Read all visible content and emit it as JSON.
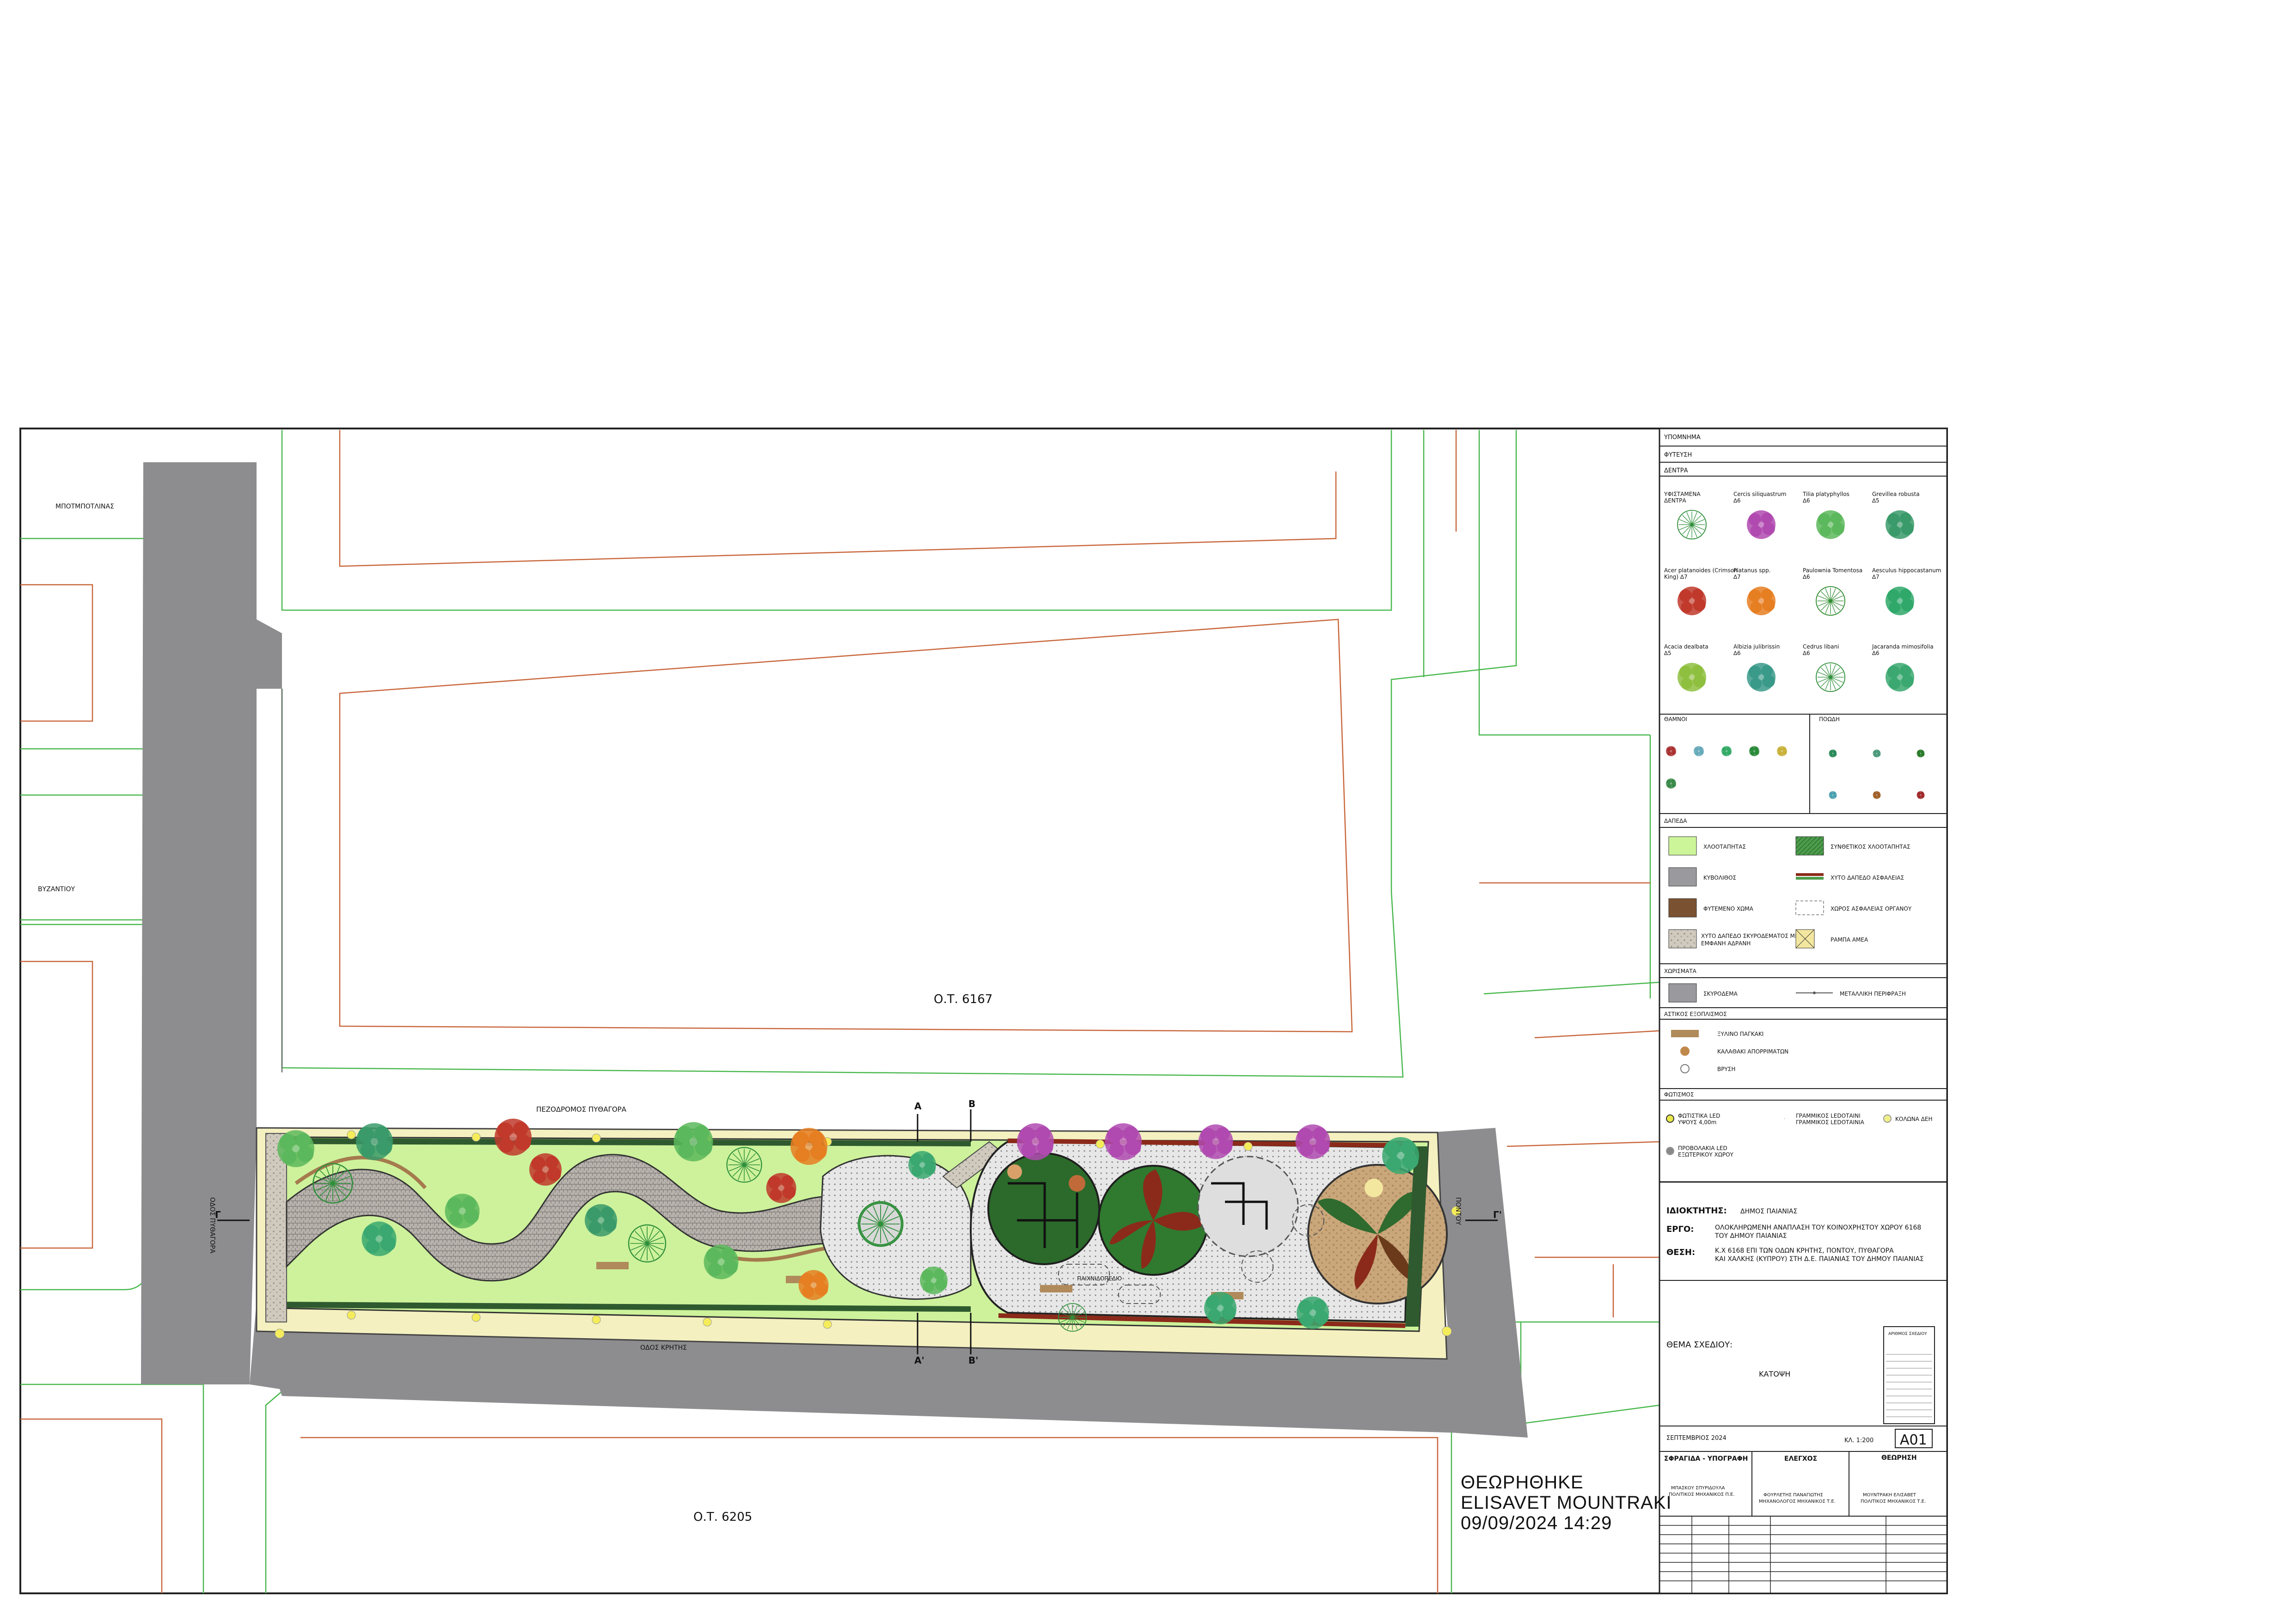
{
  "site_plan": {
    "blocks": {
      "block_north": "Ο.Τ. 6167",
      "block_south": "Ο.Τ. 6205"
    },
    "streets": {
      "street_top_left": "ΜΠΟΤΜΠΟΤΛΙΝΑΣ",
      "street_mid_left": "ΒΥΖΑΝΤΙΟΥ",
      "street_west_vertical": "ΟΔΟΣ ΠΥΘΑΓΟΡΑ",
      "pedestrian_street": "ΠΕΖΟΔΡΟΜΟΣ ΠΥΘΑΓΟΡΑ",
      "street_south": "ΟΔΟΣ ΚΡΗΤΗΣ",
      "street_east": "ΠΟΝΤΟΥ"
    },
    "section_labels": [
      "Γ",
      "Γ'",
      "Α",
      "Α'",
      "Β",
      "Β'"
    ],
    "playground_label": "ΠΑΙΧΝΙΔΟΠΕΔΙΟ"
  },
  "legend": {
    "title": "ΥΠΟΜΝΗΜΑ",
    "planting_title": "ΦΥΤΕΥΣΗ",
    "trees_title": "ΔΕΝΤΡΑ",
    "trees": [
      {
        "label": "ΥΦΙΣΤΑΜΕΝΑ ΔΕΝΤΡΑ",
        "color": "#2f8f3a",
        "style": "line"
      },
      {
        "label": "Cercis siliquastrum ∆6",
        "color": "#b04ab0",
        "style": "blob"
      },
      {
        "label": "Tilia platyphyllos ∆6",
        "color": "#5cb85c",
        "style": "blob"
      },
      {
        "label": "Grevillea robusta ∆5",
        "color": "#3a9a6a",
        "style": "blob"
      },
      {
        "label": "Acer platanoides (Crimson King) ∆7",
        "color": "#c0392b",
        "style": "blob"
      },
      {
        "label": "Platanus spp. ∆7",
        "color": "#e67e22",
        "style": "blob"
      },
      {
        "label": "Paulownia Tomentosa ∆6",
        "color": "#2e8b2e",
        "style": "line"
      },
      {
        "label": "Aesculus hippocastanum ∆7",
        "color": "#2fa86a",
        "style": "blob"
      },
      {
        "label": "Acacia dealbata ∆5",
        "color": "#8fbf3f",
        "style": "blob"
      },
      {
        "label": "Albizia julibrissin ∆6",
        "color": "#3a9a8a",
        "style": "blob"
      },
      {
        "label": "Cedrus libani ∆6",
        "color": "#2f8f3a",
        "style": "line"
      },
      {
        "label": "Jacaranda mimosifolia ∆6",
        "color": "#3aa870",
        "style": "blob"
      }
    ],
    "shrubs_title": "ΘΑΜΝΟΙ",
    "shrub_colors": [
      "#a33",
      "#6ab",
      "#3a6",
      "#2a8a3a",
      "#c9b23a",
      "#3a8a4a"
    ],
    "groundcover_title": "ΠΟΩΔΗ",
    "groundcover_colors": [
      "#2a8a5a",
      "#4a9a7a",
      "#2a7a2a",
      "#4aa0b0",
      "#a0602a",
      "#a02a2a"
    ],
    "floors_title": "ΔΑΠΕΔΑ",
    "floors": [
      {
        "label": "ΧΛΟΟΤΑΠΗΤΑΣ",
        "color": "#ccf59a"
      },
      {
        "label": "ΣΥΝΘΕΤΙΚΟΣ ΧΛΟΟΤΑΠΗΤΑΣ",
        "color": "#4c9c4c"
      },
      {
        "label": "ΚΥΒΟΛΙΘΟΣ",
        "color": "#9a9a9e"
      },
      {
        "label": "ΧΥΤΟ ΔΑΠΕΔΟ ΑΣΦΑΛΕΙΑΣ",
        "color": "#8b2a1a"
      },
      {
        "label": "ΦΥΤΕΜΕΝΟ ΧΩΜΑ",
        "color": "#7a5232"
      },
      {
        "label": "ΧΩΡΟΣ ΑΣΦΑΛΕΙΑΣ ΟΡΓΑΝΟΥ",
        "color": "#ffffff"
      },
      {
        "label": "ΧΥΤΟ ΔΑΠΕΔΟ ΣΚΥΡΟΔΕΜΑΤΟΣ ΜΕ ΕΜΦΑΝΗ ΑΔΡΑΝΗ",
        "color": "#d8d2c4"
      },
      {
        "label": "ΡΑΜΠΑ ΑΜΕΑ",
        "color": "#f3e7a0"
      }
    ],
    "walls_title": "ΧΩΡΙΣΜΑΤΑ",
    "walls": [
      {
        "label": "ΣΚΥΡΟΔΕΜΑ",
        "color": "#9a9a9e"
      },
      {
        "label": "ΜΕΤΑΛΛΙΚΗ ΠΕΡΙΦΡΑΞΗ",
        "color": "#555555"
      }
    ],
    "furniture_title": "ΑΣΤΙΚΟΣ ΕΞΟΠΛΙΣΜΟΣ",
    "furniture": [
      {
        "label": "ΞΥΛΙΝΟ ΠΑΓΚΑΚΙ",
        "color": "#b08a5a"
      },
      {
        "label": "ΚΑΛΑΘΑΚΙ ΑΠΟΡΡΙΜΑΤΩΝ",
        "color": "#c0884a"
      },
      {
        "label": "ΒΡΥΣΗ",
        "color": "#777777"
      }
    ],
    "lighting_title": "ΦΩΤΙΣΜΟΣ",
    "lighting": [
      {
        "label": "ΦΩΤΙΣΤΙΚΑ LED ΥΨΟΥΣ 4,00m",
        "color": "#e8e84a"
      },
      {
        "label": "ΓΡΑΜΜΙΚΟΣ LEDΟΤΑΙΝΙΑ",
        "color": "#333333"
      },
      {
        "label": "ΚΟΛΩΝΑ ΔΕΗ",
        "color": "#f0f08a"
      },
      {
        "label": "ΠΡΟΒΟΛΑΚΙΑ LED ΕΞΩΤΕΡΙΚΟΥ ΧΩΡΟΥ",
        "color": "#888888"
      }
    ]
  },
  "title_block": {
    "owner_label": "ΙΔΙΟΚΤΗΤΗΣ:",
    "owner_value": "ΔΗΜΟΣ ΠΑΙΑΝΙΑΣ",
    "project_label": "ΕΡΓΟ:",
    "project_value_1": "ΟΛΟΚΛΗΡΩΜΕΝΗ ΑΝΑΠΛΑΣΗ ΤΟΥ ΚΟΙΝΟΧΡΗΣΤΟΥ ΧΩΡΟΥ 6168",
    "project_value_2": "ΤΟΥ ΔΗΜΟΥ ΠΑΙΑΝΙΑΣ",
    "location_label": "ΘΕΣΗ:",
    "location_value_1": "Κ.Χ 6168 ΕΠΙ ΤΩΝ ΟΔΩΝ ΚΡΗΤΗΣ, ΠΟΝΤΟΥ, ΠΥΘΑΓΟΡΑ",
    "location_value_2": "ΚΑΙ ΧΑΛΚΗΣ (ΚΥΠΡΟΥ) ΣΤΗ Δ.Ε. ΠΑΙΑΝΙΑΣ ΤΟΥ ΔΗΜΟΥ ΠΑΙΑΝΙΑΣ",
    "subject_label": "ΘΕΜΑ ΣΧΕΔΙΟΥ:",
    "subject_value": "ΚΑΤΟΨΗ",
    "drawing_no_label": "ΑΡΙΘΜΟΣ ΣΧΕΔΙΟΥ",
    "date": "ΣΕΠΤΕΜΒΡΙΟΣ 2024",
    "scale": "ΚΛ. 1:200",
    "sheet_code": "A01",
    "stamp_label": "ΣΦΡΑΓΙΔΑ - ΥΠΟΓΡΑΦΗ",
    "check_label": "ΕΛΕΓΧΟΣ",
    "review_label": "ΘΕΩΡΗΣΗ",
    "signer_1": "ΜΠΑΣΚΟΥ ΣΠΥΡΙΔΟΥΛΑ",
    "signer_1_role": "ΠΟΛΙΤΙΚΟΣ ΜΗΧΑΝΙΚΟΣ Π.Ε.",
    "signer_2": "ΦΟΥΡΛΕΤΗΣ ΠΑΝΑΓΙΩΤΗΣ",
    "signer_2_role": "ΜΗΧΑΝΟΛΟΓΟΣ ΜΗΧΑΝΙΚΟΣ Τ.Ε.",
    "signer_3": "ΜΟΥΝΤΡΑΚΗ ΕΛΙΣΑΒΕΤ",
    "signer_3_role": "ΠΟΛΙΤΙΚΟΣ ΜΗΧΑΝΙΚΟΣ Τ.Ε."
  },
  "approval_stamp": {
    "line1": "ΘΕΩΡΗΘΗΚΕ",
    "line2": "ELISAVET MOUNTRAKI",
    "line3": "09/09/2024 14:29"
  }
}
